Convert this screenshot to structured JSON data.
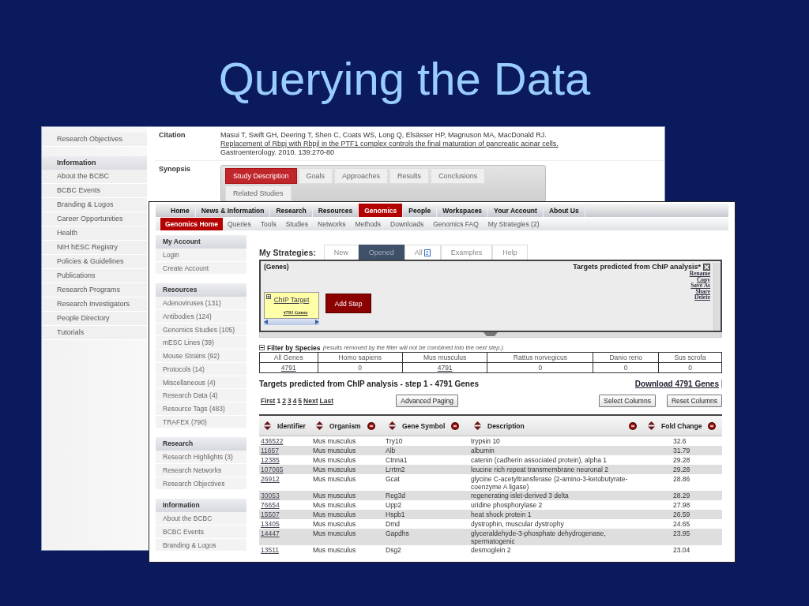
{
  "slide": {
    "title": "Querying the Data"
  },
  "back_page": {
    "sidebar": {
      "top_items": [
        "Research Objectives"
      ],
      "sections": [
        {
          "heading": "Information",
          "items": [
            "About the BCBC",
            "BCBC Events",
            "Branding & Logos",
            "Career Opportunities",
            "Health",
            "NIH hESC Registry",
            "Policies & Guidelines",
            "Publications",
            "Research Programs",
            "Research Investigators",
            "People Directory",
            "Tutorials"
          ]
        }
      ]
    },
    "citation": {
      "label": "Citation",
      "authors": "Masui T, Swift GH, Deering T, Shen C, Coats WS, Long Q, Elsässer HP, Magnuson MA, MacDonald RJ.",
      "link": "Replacement of Rbpj with Rbpjl in the PTF1 complex controls the final maturation of pancreatic acinar cells.",
      "source": "Gastroenterology. 2010. 139:270-80"
    },
    "synopsis": {
      "label": "Synopsis",
      "tabs": [
        {
          "label": "Study Description",
          "selected": true
        },
        {
          "label": "Goals",
          "selected": false
        },
        {
          "label": "Approaches",
          "selected": false
        },
        {
          "label": "Results",
          "selected": false
        },
        {
          "label": "Conclusions",
          "selected": false
        },
        {
          "label": "Related Studies",
          "selected": false
        }
      ]
    }
  },
  "front_page": {
    "nav": [
      {
        "label": "Home",
        "selected": false
      },
      {
        "label": "News & Information",
        "selected": false
      },
      {
        "label": "Research",
        "selected": false
      },
      {
        "label": "Resources",
        "selected": false
      },
      {
        "label": "Genomics",
        "selected": true
      },
      {
        "label": "People",
        "selected": false
      },
      {
        "label": "Workspaces",
        "selected": false
      },
      {
        "label": "Your Account",
        "selected": false
      },
      {
        "label": "About Us",
        "selected": false
      }
    ],
    "subnav": [
      {
        "label": "Genomics Home",
        "selected": true
      },
      {
        "label": "Queries",
        "selected": false
      },
      {
        "label": "Tools",
        "selected": false
      },
      {
        "label": "Studies",
        "selected": false
      },
      {
        "label": "Networks",
        "selected": false
      },
      {
        "label": "Methods",
        "selected": false
      },
      {
        "label": "Downloads",
        "selected": false
      },
      {
        "label": "Genomics FAQ",
        "selected": false
      },
      {
        "label": "My Strategies (2)",
        "selected": false
      }
    ],
    "sidebar": {
      "sections": [
        {
          "heading": "My Account",
          "items": [
            "Login",
            "Create Account"
          ]
        },
        {
          "heading": "Resources",
          "items": [
            "Adenoviruses (131)",
            "Antibodies (124)",
            "Genomics Studies (105)",
            "mESC Lines (39)",
            "Mouse Strains (92)",
            "Protocols (14)",
            "Miscellaneous (4)",
            "Research Data (4)",
            "Resource Tags (483)",
            "TRAFEX (790)"
          ]
        },
        {
          "heading": "Research",
          "items": [
            "Research Highlights (3)",
            "Research Networks",
            "Research Objectives"
          ]
        },
        {
          "heading": "Information",
          "items": [
            "About the BCBC",
            "BCBC Events",
            "Branding & Logos"
          ]
        }
      ]
    },
    "strategies": {
      "label": "My Strategies:",
      "tabs": [
        {
          "label": "New",
          "selected": false
        },
        {
          "label": "Opened",
          "selected": true
        },
        {
          "label": "All",
          "count": "2",
          "selected": false
        },
        {
          "label": "Examples",
          "selected": false
        },
        {
          "label": "Help",
          "selected": false
        }
      ],
      "panel": {
        "type_label": "(Genes)",
        "title": "Targets predicted from ChIP analysis*",
        "actions": [
          "Rename",
          "Copy",
          "Save As",
          "Share",
          "Delete"
        ],
        "step": {
          "name": "ChIP Target",
          "count": "4791 Genes"
        },
        "add_step": "Add Step"
      }
    },
    "filter": {
      "title": "Filter by Species",
      "note": "(results removed by the filter will not be combined into the next step.)",
      "columns": [
        {
          "label": "All Genes",
          "count": "4791",
          "linked": true
        },
        {
          "label": "Homo sapiens",
          "count": "0",
          "linked": false
        },
        {
          "label": "Mus musculus",
          "count": "4791",
          "linked": true
        },
        {
          "label": "Rattus norvegicus",
          "count": "0",
          "linked": false
        },
        {
          "label": "Danio rerio",
          "count": "0",
          "linked": false
        },
        {
          "label": "Sus scrofa",
          "count": "0",
          "linked": false
        }
      ]
    },
    "results": {
      "title": "Targets predicted from ChIP analysis - step 1 - 4791 Genes",
      "download": "Download 4791 Genes",
      "paging": [
        {
          "label": "First",
          "selected": false
        },
        {
          "label": "1",
          "selected": true
        },
        {
          "label": "2",
          "selected": false
        },
        {
          "label": "3",
          "selected": false
        },
        {
          "label": "4",
          "selected": false
        },
        {
          "label": "5",
          "selected": false
        },
        {
          "label": "Next",
          "selected": false
        },
        {
          "label": "Last",
          "selected": false
        }
      ],
      "advanced_paging": "Advanced Paging",
      "select_columns": "Select Columns",
      "reset_columns": "Reset Columns",
      "columns": [
        {
          "label": "Identifier",
          "removable": false
        },
        {
          "label": "Organism",
          "removable": true
        },
        {
          "label": "Gene Symbol",
          "removable": true
        },
        {
          "label": "Description",
          "removable": true
        },
        {
          "label": "Fold Change",
          "removable": true
        }
      ],
      "rows": [
        [
          "436522",
          "Mus musculus",
          "Try10",
          "trypsin 10",
          "32.6"
        ],
        [
          "11657",
          "Mus musculus",
          "Alb",
          "albumin",
          "31.79"
        ],
        [
          "12385",
          "Mus musculus",
          "Ctnna1",
          "catenin (cadherin associated protein), alpha 1",
          "29.28"
        ],
        [
          "107065",
          "Mus musculus",
          "Lrrtm2",
          "leucine rich repeat transmembrane neuronal 2",
          "29.28"
        ],
        [
          "26912",
          "Mus musculus",
          "Gcat",
          "glycine C-acetyltransferase (2-amino-3-ketobutyrate-coenzyme A ligase)",
          "28.86"
        ],
        [
          "30053",
          "Mus musculus",
          "Reg3d",
          "regenerating islet-derived 3 delta",
          "28.29"
        ],
        [
          "76654",
          "Mus musculus",
          "Upp2",
          "uridine phosphorylase 2",
          "27.98"
        ],
        [
          "15507",
          "Mus musculus",
          "Hspb1",
          "heat shock protein 1",
          "26.59"
        ],
        [
          "13405",
          "Mus musculus",
          "Dmd",
          "dystrophin, muscular dystrophy",
          "24.65"
        ],
        [
          "14447",
          "Mus musculus",
          "Gapdhs",
          "glyceraldehyde-3-phosphate dehydrogenase, spermatogenic",
          "23.95"
        ],
        [
          "13511",
          "Mus musculus",
          "Dsg2",
          "desmoglein 2",
          "23.04"
        ]
      ]
    }
  }
}
